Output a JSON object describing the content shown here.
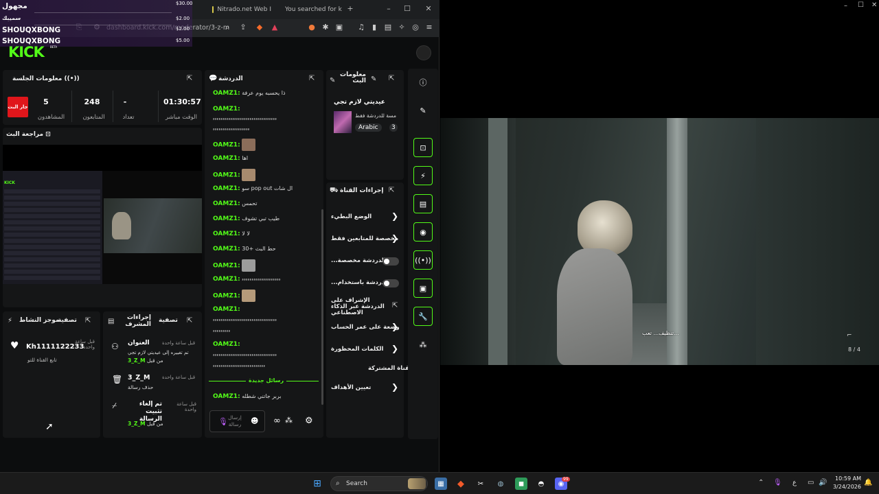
{
  "browser": {
    "tabs": [
      {
        "label": "Nitrado.net Web I"
      },
      {
        "label": "You searched for k"
      }
    ],
    "url": "dashboard.kick.com/moderator/3-z-m",
    "new_tab": "+",
    "minimize": "–",
    "maximize": "☐",
    "close": "✕"
  },
  "overlay": {
    "donations": [
      {
        "name": "مجهول",
        "amount": "$30.00"
      },
      {
        "name": "سميبك",
        "amount": "$2.00"
      },
      {
        "name": "SHOUQXBONG",
        "amount": "$2.00"
      },
      {
        "name": "SHOUQXBONG",
        "amount": "$5.00"
      }
    ]
  },
  "kick": {
    "logo": "KICK",
    "beta": "BETA"
  },
  "session": {
    "title": "معلومات الجلسة",
    "live_badge": "جار البث",
    "stats": [
      {
        "value": "5",
        "label": "المشاهدون"
      },
      {
        "value": "248",
        "label": "المتابعون"
      },
      {
        "value": "-",
        "label": "تعداد"
      },
      {
        "value": "01:30:57",
        "label": "الوقت مباشر"
      }
    ]
  },
  "preview": {
    "title": "مراجعة البث"
  },
  "chat": {
    "title": "الدردشة",
    "messages": [
      {
        "user": "OAMZ1:",
        "text": "ذا يحسبه يوم عرفة"
      },
      {
        "user": "OAMZ1:",
        "text": ""
      },
      {
        "user": "",
        "text": "ءءءءءءءءءءءءءءءءءءءءءءءءءءءءءءءءء"
      },
      {
        "user": "",
        "text": "ءءءءءءءءءءءءءءءءءءء"
      },
      {
        "user": "OAMZ1:",
        "text": ""
      },
      {
        "user": "OAMZ1:",
        "text": "اها"
      },
      {
        "user": "OAMZ1:",
        "text": ""
      },
      {
        "user": "OAMZ1:",
        "text": "سو pop out ال شات"
      },
      {
        "user": "OAMZ1:",
        "text": "تحمس"
      },
      {
        "user": "OAMZ1:",
        "text": "طيب تبي تشوف"
      },
      {
        "user": "OAMZ1:",
        "text": "لا لا"
      },
      {
        "user": "OAMZ1:",
        "text": "حط البث +30"
      },
      {
        "user": "OAMZ1:",
        "text": ""
      },
      {
        "user": "OAMZ1:",
        "text": "ءءءءءءءءءءءءءءءءءءءء"
      },
      {
        "user": "OAMZ1:",
        "text": ""
      },
      {
        "user": "OAMZ1:",
        "text": ""
      },
      {
        "user": "",
        "text": "ءءءءءءءءءءءءءءءءءءءءءءءءءءءءءءءءء"
      },
      {
        "user": "",
        "text": "ءءءءءءءءء"
      },
      {
        "user": "OAMZ1:",
        "text": ""
      },
      {
        "user": "",
        "text": "ءءءءءءءءءءءءءءءءءءءءءءءءءءءءءءءءء"
      },
      {
        "user": "",
        "text": "ءءءءءءءءءءءءءءءءءءءءءءءءءءء"
      }
    ],
    "new_messages": "رسائل جديدة",
    "last_message": {
      "user": "OAMZ1:",
      "text": "بربر جاتني شطله"
    },
    "input_placeholder": "إرسال رسالة"
  },
  "stream_info": {
    "title": "معلومات البث",
    "stream_title": "عيديتي لازم تجي",
    "category_text": "مسة للدردشة فقط",
    "language": "Arabic",
    "count": "3"
  },
  "channel_actions": {
    "title": "إجراءات القناة",
    "items": [
      {
        "label": "الوضع البطيء",
        "control": "chevron"
      },
      {
        "label": "مخصصة للمتابعين فقط",
        "control": "chevron"
      },
      {
        "label": "الدردشة مخصصة...",
        "control": "toggle"
      },
      {
        "label": "الدردشة باستخدام...",
        "control": "toggle"
      },
      {
        "label": "الإشراف على الدردشة عبر الذكاء الاصطناعي",
        "control": "link"
      },
      {
        "label": "وضعة على عمر الحساب",
        "control": "chevron"
      },
      {
        "label": "الكلمات المحظورة",
        "control": "chevron"
      },
      {
        "label": "القناة المشتركة",
        "control": "none"
      },
      {
        "label": "تعيين الأهداف",
        "control": "chevron"
      }
    ]
  },
  "activity": {
    "title": "موجز النشاط",
    "filter": "تصفية",
    "item": {
      "name": "Kh1111122233",
      "time": "قبل ساعة واحدة",
      "desc": "تابع القناة للتو"
    }
  },
  "mod_actions": {
    "title": "إجراءات المشرف",
    "filter": "تصفية",
    "items": [
      {
        "title": "العنوان",
        "time": "قبل ساعة واحدة",
        "desc": "تم تغييره إلى عيديتي لازم تجي",
        "by": "من قبل",
        "user": "3_Z_M"
      },
      {
        "title": "3_Z_M",
        "time": "قبل ساعة واحدة",
        "desc": "حذف رسالة",
        "by": "",
        "user": ""
      },
      {
        "title": "تم إلغاء تثبيت الرسالة",
        "time": "قبل ساعة واحدة",
        "desc": "",
        "by": "من قبل",
        "user": "3_Z_M"
      }
    ]
  },
  "video": {
    "subtitle": "تنظيف... تعب...",
    "ammo": "8 / 4"
  },
  "taskbar": {
    "search": "Search",
    "lang": "ع",
    "time": "10:59 AM",
    "date": "3/24/2026",
    "discord_badge": "99"
  },
  "colors": {
    "accent": "#53fc18",
    "live": "#e0161b",
    "panel": "#151617"
  }
}
